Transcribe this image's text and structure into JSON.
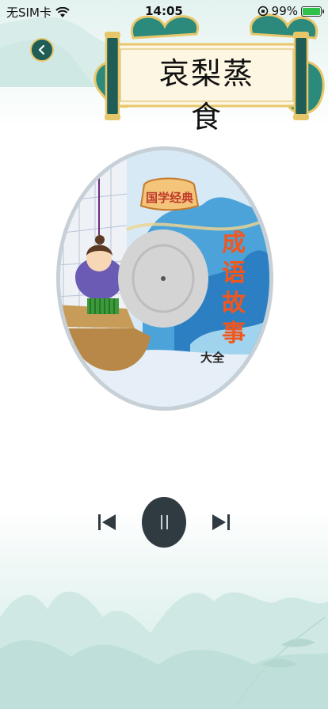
{
  "status_bar": {
    "carrier": "无SIM卡",
    "time": "14:05",
    "battery_percent": "99%",
    "battery_level": 0.99
  },
  "header": {
    "back_icon": "chevron-left-icon",
    "title": "哀梨蒸食"
  },
  "cover": {
    "badge": "国学经典",
    "title_line1": "成",
    "title_line2": "语",
    "title_line3": "故",
    "title_line4": "事",
    "subtitle": "大全"
  },
  "player": {
    "prev_icon": "skip-previous-icon",
    "pause_icon": "pause-icon",
    "next_icon": "skip-next-icon"
  },
  "colors": {
    "accent_teal": "#1f5d56",
    "gold": "#e8c76a",
    "control_dark": "#2f3a41",
    "title_orange": "#f2561d"
  }
}
